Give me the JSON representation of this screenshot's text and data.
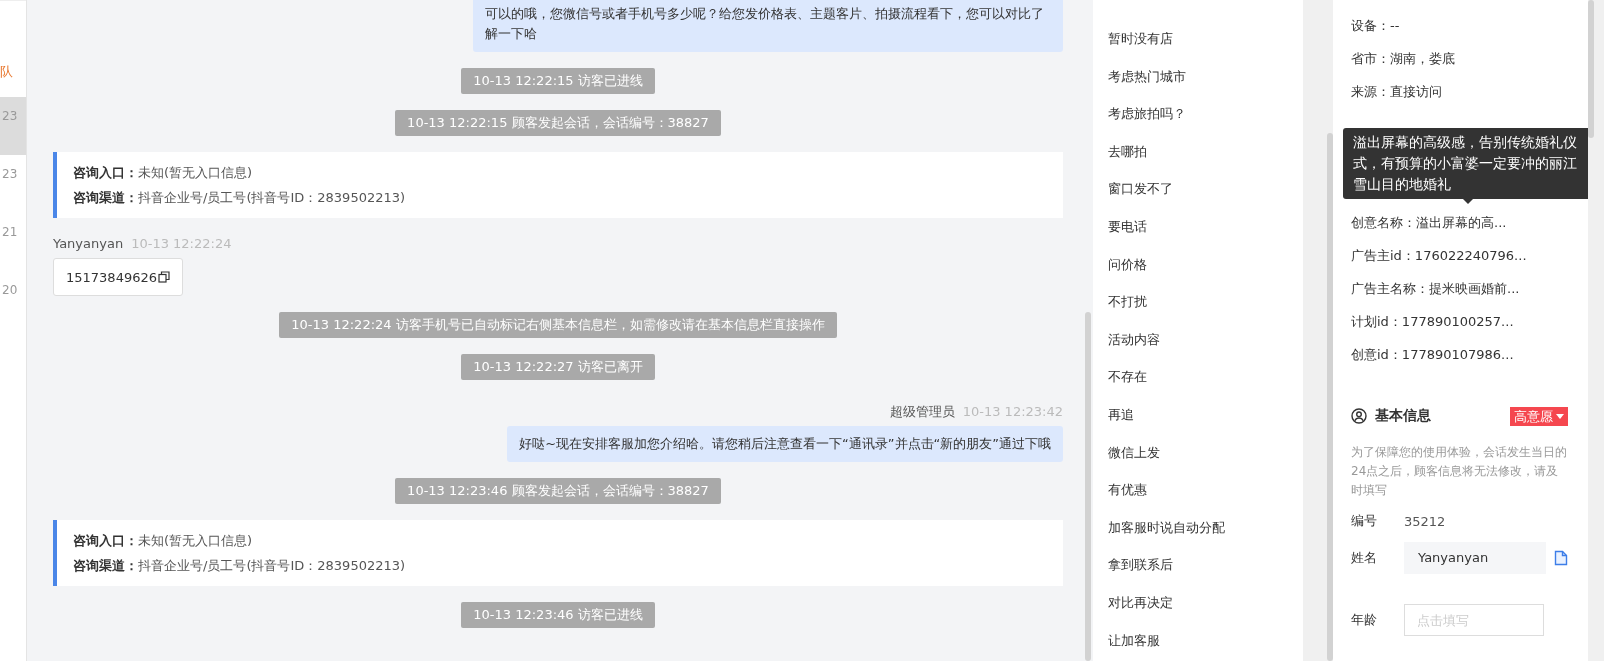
{
  "left_strip": {
    "label": "队",
    "items": [
      {
        "text": "23",
        "selected": true
      },
      {
        "text": "23",
        "selected": false
      },
      {
        "text": "21",
        "selected": false
      },
      {
        "text": "20",
        "selected": false
      }
    ]
  },
  "chat": {
    "messages": [
      {
        "kind": "outgoing",
        "text": "可以的哦，您微信号或者手机号多少呢？给您发价格表、主题客片、拍摄流程看下，您可以对比了解一下哈"
      },
      {
        "kind": "system",
        "text": "10-13 12:22:15 访客已进线"
      },
      {
        "kind": "system",
        "text": "10-13 12:22:15 顾客发起会话，会话编号：38827"
      },
      {
        "kind": "source_card",
        "entry_label": "咨询入口：",
        "entry_value": "未知(暂无入口信息)",
        "channel_label": "咨询渠道：",
        "channel_value": "抖音企业号/员工号(抖音号ID：2839502213)"
      },
      {
        "kind": "incoming",
        "sender": "Yanyanyan",
        "time": "10-13 12:22:24",
        "text": "15173849626"
      },
      {
        "kind": "system",
        "text": "10-13 12:22:24 访客手机号已自动标记右侧基本信息栏，如需修改请在基本信息栏直接操作"
      },
      {
        "kind": "system",
        "text": "10-13 12:22:27 访客已离开"
      },
      {
        "kind": "outgoing",
        "sender": "超级管理员",
        "time": "10-13 12:23:42",
        "text": "好哒~现在安排客服加您介绍哈。请您稍后注意查看一下“通讯录”并点击“新的朋友”通过下哦"
      },
      {
        "kind": "system",
        "text": "10-13 12:23:46 顾客发起会话，会话编号：38827"
      },
      {
        "kind": "source_card",
        "entry_label": "咨询入口：",
        "entry_value": "未知(暂无入口信息)",
        "channel_label": "咨询渠道：",
        "channel_value": "抖音企业号/员工号(抖音号ID：2839502213)"
      },
      {
        "kind": "system",
        "text": "10-13 12:23:46 访客已进线"
      }
    ]
  },
  "quick_replies": [
    "暂时没有店",
    "考虑热门城市",
    "考虑旅拍吗？",
    "去哪拍",
    "窗口发不了",
    "要电话",
    "问价格",
    "不打扰",
    "活动内容",
    "不存在",
    "再追",
    "微信上发",
    "有优惠",
    "加客服时说自动分配",
    "拿到联系后",
    "对比再决定",
    "让加客服"
  ],
  "visitor_info": {
    "fields": [
      "设备：--",
      "省市：湖南，娄底",
      "来源：直接访问",
      "创意名称：溢出屏幕的高...",
      "广告主id：176022240796...",
      "广告主名称：提米映画婚前...",
      "计划id：177890100257...",
      "创意id：177890107986..."
    ],
    "tooltip": "溢出屏幕的高级感，告别传统婚礼仪式，有预算的小富婆一定要冲的丽江雪山目的地婚礼"
  },
  "basic_info": {
    "title": "基本信息",
    "intent_tag": "高意愿",
    "notice": "为了保障您的使用体验，会话发生当日的24点之后，顾客信息将无法修改，请及时填写",
    "number_label": "编号",
    "number": "35212",
    "name_label": "姓名",
    "name_value": "Yanyanyan",
    "age_label": "年龄",
    "age_placeholder": "点击填写"
  }
}
